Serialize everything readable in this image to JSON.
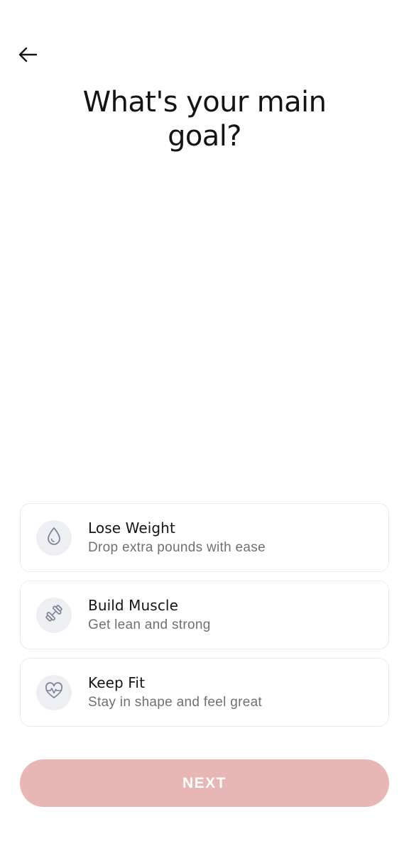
{
  "header": {
    "back_icon": "arrow-left-icon",
    "title_line1": "What's your main",
    "title_line2": "goal?"
  },
  "options": [
    {
      "title": "Lose Weight",
      "subtitle": "Drop extra pounds with ease",
      "icon": "water-drop-icon"
    },
    {
      "title": "Build Muscle",
      "subtitle": "Get lean and strong",
      "icon": "dumbbell-icon"
    },
    {
      "title": "Keep Fit",
      "subtitle": "Stay in shape and feel great",
      "icon": "heart-pulse-icon"
    }
  ],
  "footer": {
    "next_label": "NEXT"
  },
  "colors": {
    "background": "#ffffff",
    "title": "#141414",
    "subtitle": "#707074",
    "card_border": "#ebebef",
    "icon_bg": "#eeeff3",
    "icon_stroke": "#7d8496",
    "next_button_disabled": "#e8b6b5",
    "next_text": "#ffffff"
  }
}
